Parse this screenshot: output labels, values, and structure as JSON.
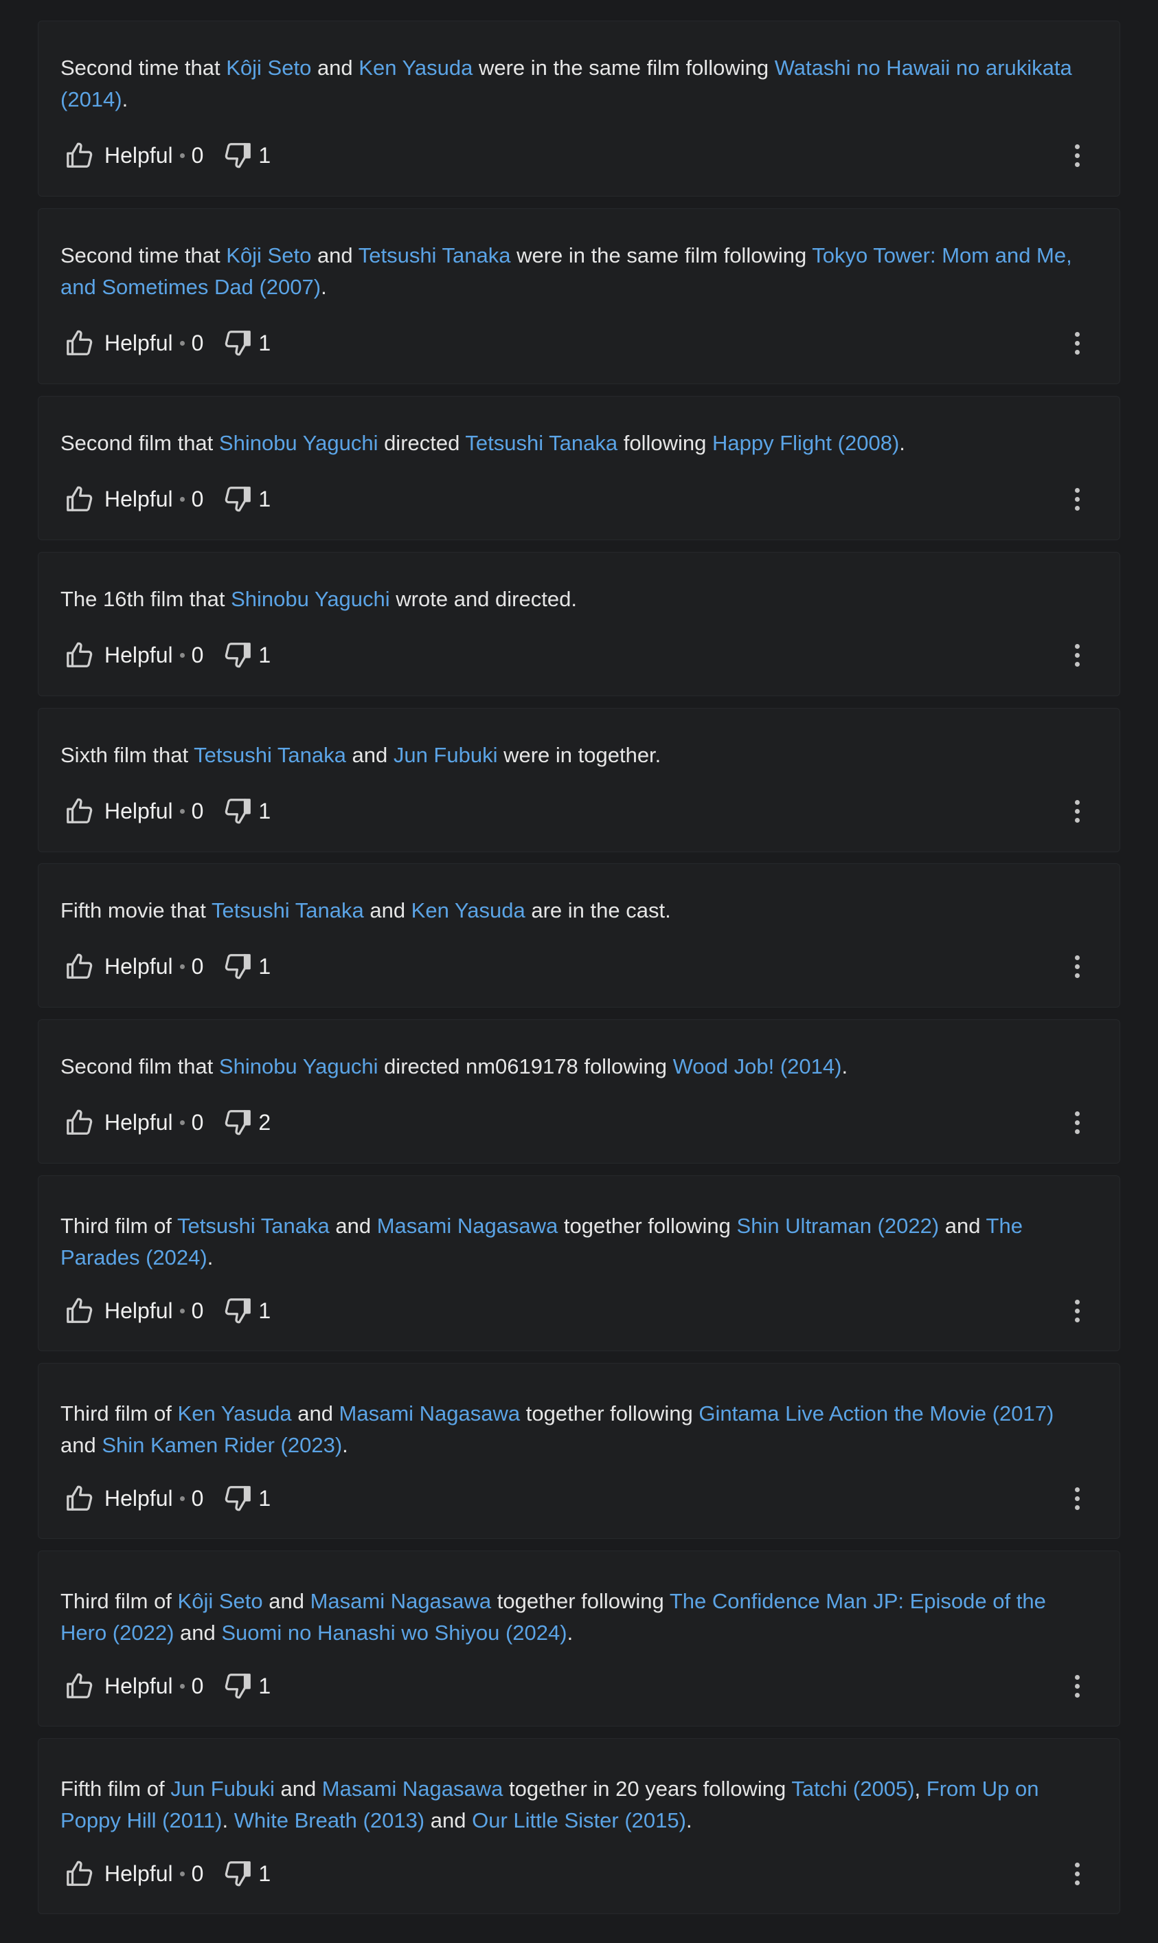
{
  "reviews": [
    {
      "segments": [
        {
          "t": "Second time that "
        },
        {
          "t": "Kôji Seto",
          "link": true
        },
        {
          "t": " and "
        },
        {
          "t": "Ken Yasuda",
          "link": true
        },
        {
          "t": " were in the same film following "
        },
        {
          "t": "Watashi no Hawaii no arukikata (2014)",
          "link": true
        },
        {
          "t": "."
        }
      ],
      "helpful_label": "Helpful",
      "helpful_count": "0",
      "unhelpful_count": "1"
    },
    {
      "segments": [
        {
          "t": "Second time that "
        },
        {
          "t": "Kôji Seto",
          "link": true
        },
        {
          "t": " and "
        },
        {
          "t": "Tetsushi Tanaka",
          "link": true
        },
        {
          "t": " were in the same film following "
        },
        {
          "t": "Tokyo Tower: Mom and Me, and Sometimes Dad (2007)",
          "link": true
        },
        {
          "t": "."
        }
      ],
      "helpful_label": "Helpful",
      "helpful_count": "0",
      "unhelpful_count": "1"
    },
    {
      "segments": [
        {
          "t": "Second film that "
        },
        {
          "t": "Shinobu Yaguchi",
          "link": true
        },
        {
          "t": " directed "
        },
        {
          "t": "Tetsushi Tanaka",
          "link": true
        },
        {
          "t": " following "
        },
        {
          "t": "Happy Flight (2008)",
          "link": true
        },
        {
          "t": "."
        }
      ],
      "helpful_label": "Helpful",
      "helpful_count": "0",
      "unhelpful_count": "1"
    },
    {
      "segments": [
        {
          "t": "The 16th film that "
        },
        {
          "t": "Shinobu Yaguchi",
          "link": true
        },
        {
          "t": " wrote and directed."
        }
      ],
      "helpful_label": "Helpful",
      "helpful_count": "0",
      "unhelpful_count": "1"
    },
    {
      "segments": [
        {
          "t": "Sixth film that "
        },
        {
          "t": "Tetsushi Tanaka",
          "link": true
        },
        {
          "t": " and "
        },
        {
          "t": "Jun Fubuki",
          "link": true
        },
        {
          "t": " were in together."
        }
      ],
      "helpful_label": "Helpful",
      "helpful_count": "0",
      "unhelpful_count": "1"
    },
    {
      "segments": [
        {
          "t": "Fifth movie that "
        },
        {
          "t": "Tetsushi Tanaka",
          "link": true
        },
        {
          "t": " and "
        },
        {
          "t": "Ken Yasuda",
          "link": true
        },
        {
          "t": " are in the cast."
        }
      ],
      "helpful_label": "Helpful",
      "helpful_count": "0",
      "unhelpful_count": "1"
    },
    {
      "segments": [
        {
          "t": "Second film that "
        },
        {
          "t": "Shinobu Yaguchi",
          "link": true
        },
        {
          "t": " directed nm0619178 following "
        },
        {
          "t": "Wood Job! (2014)",
          "link": true
        },
        {
          "t": "."
        }
      ],
      "helpful_label": "Helpful",
      "helpful_count": "0",
      "unhelpful_count": "2"
    },
    {
      "segments": [
        {
          "t": "Third film of "
        },
        {
          "t": "Tetsushi Tanaka",
          "link": true
        },
        {
          "t": " and "
        },
        {
          "t": "Masami Nagasawa",
          "link": true
        },
        {
          "t": " together following "
        },
        {
          "t": "Shin Ultraman (2022)",
          "link": true
        },
        {
          "t": " and "
        },
        {
          "t": "The Parades (2024)",
          "link": true
        },
        {
          "t": "."
        }
      ],
      "helpful_label": "Helpful",
      "helpful_count": "0",
      "unhelpful_count": "1"
    },
    {
      "segments": [
        {
          "t": "Third film of "
        },
        {
          "t": "Ken Yasuda",
          "link": true
        },
        {
          "t": " and "
        },
        {
          "t": "Masami Nagasawa",
          "link": true
        },
        {
          "t": " together following "
        },
        {
          "t": "Gintama Live Action the Movie (2017)",
          "link": true
        },
        {
          "t": " and "
        },
        {
          "t": "Shin Kamen Rider (2023)",
          "link": true
        },
        {
          "t": "."
        }
      ],
      "helpful_label": "Helpful",
      "helpful_count": "0",
      "unhelpful_count": "1"
    },
    {
      "segments": [
        {
          "t": "Third film of "
        },
        {
          "t": "Kôji Seto",
          "link": true
        },
        {
          "t": " and "
        },
        {
          "t": "Masami Nagasawa",
          "link": true
        },
        {
          "t": " together following "
        },
        {
          "t": "The Confidence Man JP: Episode of the Hero (2022)",
          "link": true
        },
        {
          "t": " and "
        },
        {
          "t": "Suomi no Hanashi wo Shiyou (2024)",
          "link": true
        },
        {
          "t": "."
        }
      ],
      "helpful_label": "Helpful",
      "helpful_count": "0",
      "unhelpful_count": "1"
    },
    {
      "segments": [
        {
          "t": "Fifth film of "
        },
        {
          "t": "Jun Fubuki",
          "link": true
        },
        {
          "t": " and "
        },
        {
          "t": "Masami Nagasawa",
          "link": true
        },
        {
          "t": " together in 20 years following "
        },
        {
          "t": "Tatchi (2005)",
          "link": true
        },
        {
          "t": ", "
        },
        {
          "t": "From Up on Poppy Hill (2011)",
          "link": true
        },
        {
          "t": ". "
        },
        {
          "t": "White Breath (2013)",
          "link": true
        },
        {
          "t": " and "
        },
        {
          "t": "Our Little Sister (2015)",
          "link": true
        },
        {
          "t": "."
        }
      ],
      "helpful_label": "Helpful",
      "helpful_count": "0",
      "unhelpful_count": "1"
    }
  ],
  "colors": {
    "background": "#1a1b1d",
    "card": "#1e1f21",
    "link": "#5ba4e6",
    "text": "#e6e6e6"
  },
  "icons": {
    "helpful": "thumbs-up-icon",
    "unhelpful": "thumbs-down-icon",
    "more": "more-options-icon"
  }
}
